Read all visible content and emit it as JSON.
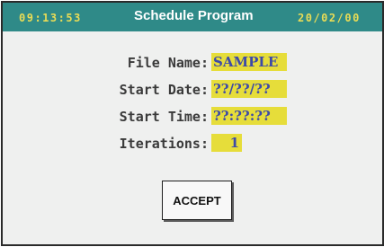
{
  "header": {
    "time": "09:13:53",
    "title": "Schedule Program",
    "date": "20/02/00"
  },
  "form": {
    "file_name": {
      "label": "File Name:",
      "value": "SAMPLE"
    },
    "start_date": {
      "label": "Start Date:",
      "value": "??/??/??"
    },
    "start_time": {
      "label": "Start Time:",
      "value": "??:??:??"
    },
    "iterations": {
      "label": "Iterations:",
      "value": "1"
    }
  },
  "actions": {
    "accept_label": "ACCEPT"
  },
  "colors": {
    "title_bar": "#2f8a88",
    "header_text": "#e9dc56",
    "field_background": "#e6dd3a",
    "field_text": "#3d4aa8",
    "panel_background": "#eff0ef"
  }
}
